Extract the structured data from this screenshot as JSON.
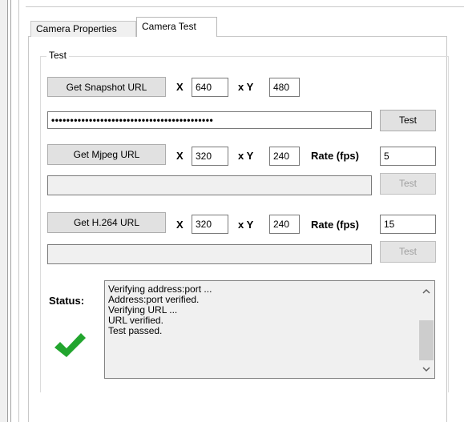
{
  "tabs": [
    {
      "label": "Camera Properties",
      "active": false
    },
    {
      "label": "Camera Test",
      "active": true
    }
  ],
  "group": {
    "title": "Test"
  },
  "snapshot": {
    "button": "Get Snapshot URL",
    "x_label": "X",
    "x_value": "640",
    "y_label": "x Y",
    "y_value": "480",
    "url_value": "•••••••••••••••••••••••••••••••••••••••••••",
    "test_button": "Test"
  },
  "mjpeg": {
    "button": "Get Mjpeg URL",
    "x_label": "X",
    "x_value": "320",
    "y_label": "x Y",
    "y_value": "240",
    "rate_label": "Rate (fps)",
    "rate_value": "5",
    "url_value": "",
    "test_button": "Test"
  },
  "h264": {
    "button": "Get H.264 URL",
    "x_label": "X",
    "x_value": "320",
    "y_label": "x Y",
    "y_value": "240",
    "rate_label": "Rate (fps)",
    "rate_value": "15",
    "url_value": "",
    "test_button": "Test"
  },
  "status": {
    "label": "Status:",
    "lines": [
      "Verifying address:port ...",
      "Address:port verified.",
      "Verifying URL ...",
      "URL verified.",
      "Test passed."
    ]
  },
  "icons": {
    "status": "check-icon",
    "scroll_up": "chevron-up-icon",
    "scroll_down": "chevron-down-icon"
  },
  "colors": {
    "check": "#22a52e",
    "button_bg": "#e1e1e1",
    "panel_border": "#c8c8c8"
  }
}
